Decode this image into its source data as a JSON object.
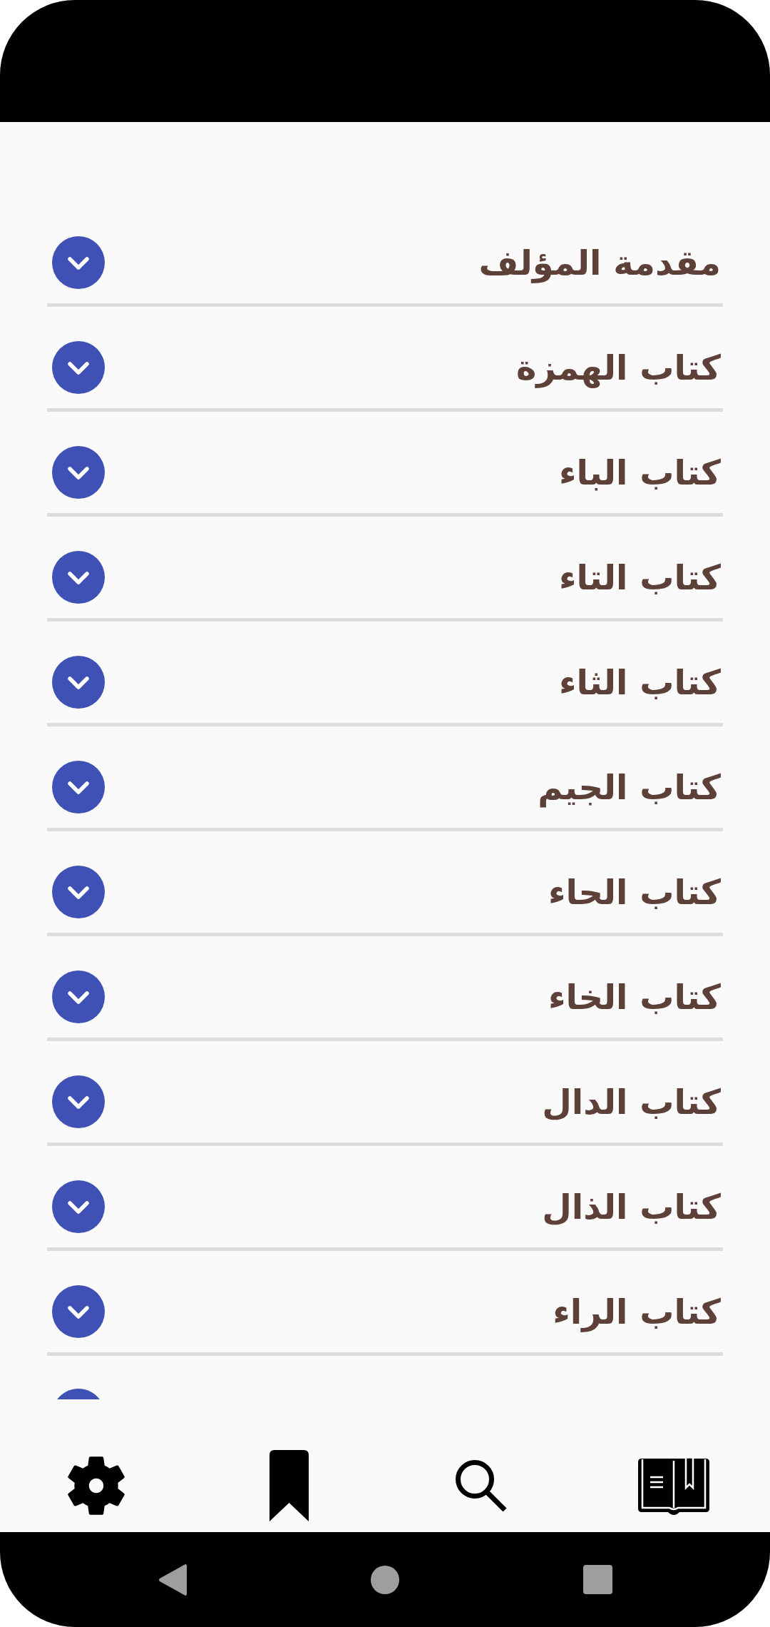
{
  "chapters": [
    {
      "title": "مقدمة المؤلف",
      "expanded": false
    },
    {
      "title": "كتاب الهمزة",
      "expanded": false
    },
    {
      "title": "كتاب الباء",
      "expanded": false
    },
    {
      "title": "كتاب التاء",
      "expanded": false
    },
    {
      "title": "كتاب الثاء",
      "expanded": false
    },
    {
      "title": "كتاب الجيم",
      "expanded": false
    },
    {
      "title": "كتاب الحاء",
      "expanded": false
    },
    {
      "title": "كتاب الخاء",
      "expanded": false
    },
    {
      "title": "كتاب الدال",
      "expanded": false
    },
    {
      "title": "كتاب الذال",
      "expanded": false
    },
    {
      "title": "كتاب الراء",
      "expanded": false
    }
  ]
}
